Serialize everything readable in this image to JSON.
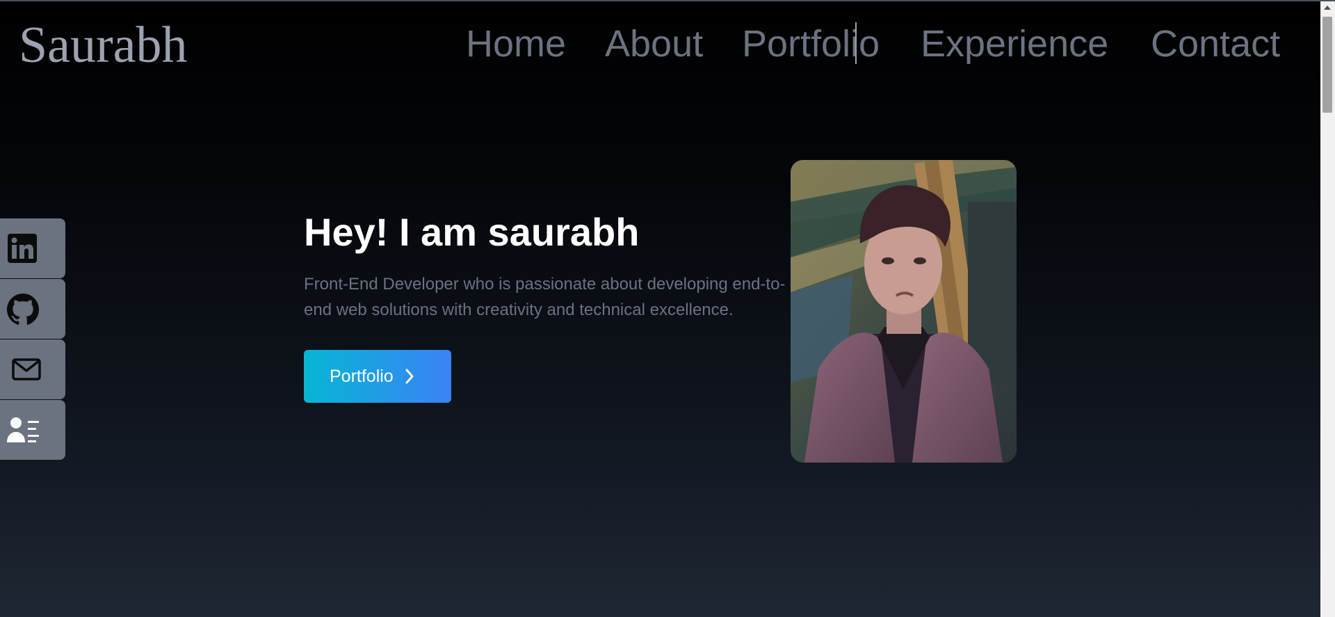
{
  "logo": "Saurabh",
  "nav": {
    "home": "Home",
    "about": "About",
    "portfolio": "Portfolio",
    "experience": "Experience",
    "contact": "Contact"
  },
  "social_links": [
    {
      "icon": "linkedin-icon"
    },
    {
      "icon": "github-icon"
    },
    {
      "icon": "mail-icon"
    },
    {
      "icon": "resume-icon"
    }
  ],
  "hero": {
    "headline": "Hey! I am saurabh",
    "intro": "Front-End Developer who is passionate about developing end-to-end web solutions with creativity and technical excellence.",
    "cta_label": "Portfolio",
    "cta_icon": "chevron-right-icon"
  },
  "profile_photo": {
    "icon": "profile-photo"
  },
  "colors": {
    "background_top": "#000000",
    "background_bottom": "#1e2734",
    "nav_text": "#6b7280",
    "headline": "#ffffff",
    "cta_gradient_start": "#06b6d4",
    "cta_gradient_end": "#3b82f6",
    "social_bar": "#6b7280"
  }
}
